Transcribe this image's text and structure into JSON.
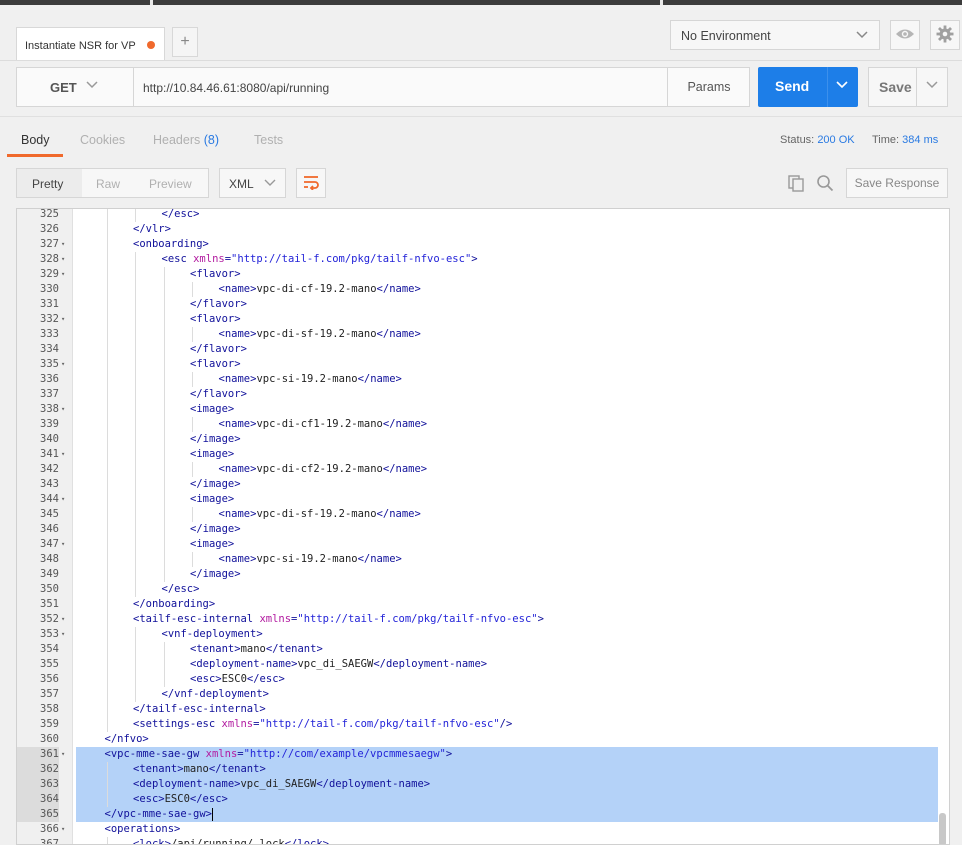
{
  "tabs": {
    "active_tab_label": "Instantiate NSR for VP",
    "add_tab_symbol": "+"
  },
  "environment": {
    "selected": "No Environment"
  },
  "request": {
    "method": "GET",
    "url": "http://10.84.46.61:8080/api/running",
    "params_label": "Params",
    "send_label": "Send",
    "save_label": "Save"
  },
  "response_tabs": {
    "body": "Body",
    "cookies": "Cookies",
    "headers": "Headers",
    "headers_count": "(8)",
    "tests": "Tests"
  },
  "response_status": {
    "status_label": "Status:",
    "status_value": "200 OK",
    "time_label": "Time:",
    "time_value": "384 ms"
  },
  "view_modes": {
    "pretty": "Pretty",
    "raw": "Raw",
    "preview": "Preview",
    "format": "XML",
    "save_response": "Save Response"
  },
  "colors": {
    "send_blue": "#1d7ee8",
    "accent_orange": "#f0692c",
    "selection": "#b4d2f8",
    "xml_tag": "#10109a",
    "xml_attr": "#b21ba0",
    "xml_string": "#2323d8"
  },
  "code_lines": [
    {
      "n": "325",
      "fold": false,
      "indent": 3,
      "parts": [
        [
          "t",
          "</esc>"
        ]
      ]
    },
    {
      "n": "326",
      "fold": false,
      "indent": 2,
      "parts": [
        [
          "t",
          "</vlr>"
        ]
      ]
    },
    {
      "n": "327",
      "fold": true,
      "indent": 2,
      "parts": [
        [
          "t",
          "<onboarding>"
        ]
      ]
    },
    {
      "n": "328",
      "fold": true,
      "indent": 3,
      "parts": [
        [
          "t",
          "<esc "
        ],
        [
          "a",
          "xmlns"
        ],
        [
          "t",
          "="
        ],
        [
          "s",
          "\"http://tail-f.com/pkg/tailf-nfvo-esc\""
        ],
        [
          "t",
          ">"
        ]
      ]
    },
    {
      "n": "329",
      "fold": true,
      "indent": 4,
      "parts": [
        [
          "t",
          "<flavor>"
        ]
      ]
    },
    {
      "n": "330",
      "fold": false,
      "indent": 5,
      "parts": [
        [
          "t",
          "<name>"
        ],
        [
          "x",
          "vpc-di-cf-19.2-mano"
        ],
        [
          "t",
          "</name>"
        ]
      ]
    },
    {
      "n": "331",
      "fold": false,
      "indent": 4,
      "parts": [
        [
          "t",
          "</flavor>"
        ]
      ]
    },
    {
      "n": "332",
      "fold": true,
      "indent": 4,
      "parts": [
        [
          "t",
          "<flavor>"
        ]
      ]
    },
    {
      "n": "333",
      "fold": false,
      "indent": 5,
      "parts": [
        [
          "t",
          "<name>"
        ],
        [
          "x",
          "vpc-di-sf-19.2-mano"
        ],
        [
          "t",
          "</name>"
        ]
      ]
    },
    {
      "n": "334",
      "fold": false,
      "indent": 4,
      "parts": [
        [
          "t",
          "</flavor>"
        ]
      ]
    },
    {
      "n": "335",
      "fold": true,
      "indent": 4,
      "parts": [
        [
          "t",
          "<flavor>"
        ]
      ]
    },
    {
      "n": "336",
      "fold": false,
      "indent": 5,
      "parts": [
        [
          "t",
          "<name>"
        ],
        [
          "x",
          "vpc-si-19.2-mano"
        ],
        [
          "t",
          "</name>"
        ]
      ]
    },
    {
      "n": "337",
      "fold": false,
      "indent": 4,
      "parts": [
        [
          "t",
          "</flavor>"
        ]
      ]
    },
    {
      "n": "338",
      "fold": true,
      "indent": 4,
      "parts": [
        [
          "t",
          "<image>"
        ]
      ]
    },
    {
      "n": "339",
      "fold": false,
      "indent": 5,
      "parts": [
        [
          "t",
          "<name>"
        ],
        [
          "x",
          "vpc-di-cf1-19.2-mano"
        ],
        [
          "t",
          "</name>"
        ]
      ]
    },
    {
      "n": "340",
      "fold": false,
      "indent": 4,
      "parts": [
        [
          "t",
          "</image>"
        ]
      ]
    },
    {
      "n": "341",
      "fold": true,
      "indent": 4,
      "parts": [
        [
          "t",
          "<image>"
        ]
      ]
    },
    {
      "n": "342",
      "fold": false,
      "indent": 5,
      "parts": [
        [
          "t",
          "<name>"
        ],
        [
          "x",
          "vpc-di-cf2-19.2-mano"
        ],
        [
          "t",
          "</name>"
        ]
      ]
    },
    {
      "n": "343",
      "fold": false,
      "indent": 4,
      "parts": [
        [
          "t",
          "</image>"
        ]
      ]
    },
    {
      "n": "344",
      "fold": true,
      "indent": 4,
      "parts": [
        [
          "t",
          "<image>"
        ]
      ]
    },
    {
      "n": "345",
      "fold": false,
      "indent": 5,
      "parts": [
        [
          "t",
          "<name>"
        ],
        [
          "x",
          "vpc-di-sf-19.2-mano"
        ],
        [
          "t",
          "</name>"
        ]
      ]
    },
    {
      "n": "346",
      "fold": false,
      "indent": 4,
      "parts": [
        [
          "t",
          "</image>"
        ]
      ]
    },
    {
      "n": "347",
      "fold": true,
      "indent": 4,
      "parts": [
        [
          "t",
          "<image>"
        ]
      ]
    },
    {
      "n": "348",
      "fold": false,
      "indent": 5,
      "parts": [
        [
          "t",
          "<name>"
        ],
        [
          "x",
          "vpc-si-19.2-mano"
        ],
        [
          "t",
          "</name>"
        ]
      ]
    },
    {
      "n": "349",
      "fold": false,
      "indent": 4,
      "parts": [
        [
          "t",
          "</image>"
        ]
      ]
    },
    {
      "n": "350",
      "fold": false,
      "indent": 3,
      "parts": [
        [
          "t",
          "</esc>"
        ]
      ]
    },
    {
      "n": "351",
      "fold": false,
      "indent": 2,
      "parts": [
        [
          "t",
          "</onboarding>"
        ]
      ]
    },
    {
      "n": "352",
      "fold": true,
      "indent": 2,
      "parts": [
        [
          "t",
          "<tailf-esc-internal "
        ],
        [
          "a",
          "xmlns"
        ],
        [
          "t",
          "="
        ],
        [
          "s",
          "\"http://tail-f.com/pkg/tailf-nfvo-esc\""
        ],
        [
          "t",
          ">"
        ]
      ]
    },
    {
      "n": "353",
      "fold": true,
      "indent": 3,
      "parts": [
        [
          "t",
          "<vnf-deployment>"
        ]
      ]
    },
    {
      "n": "354",
      "fold": false,
      "indent": 4,
      "parts": [
        [
          "t",
          "<tenant>"
        ],
        [
          "x",
          "mano"
        ],
        [
          "t",
          "</tenant>"
        ]
      ]
    },
    {
      "n": "355",
      "fold": false,
      "indent": 4,
      "parts": [
        [
          "t",
          "<deployment-name>"
        ],
        [
          "x",
          "vpc_di_SAEGW"
        ],
        [
          "t",
          "</deployment-name>"
        ]
      ]
    },
    {
      "n": "356",
      "fold": false,
      "indent": 4,
      "parts": [
        [
          "t",
          "<esc>"
        ],
        [
          "x",
          "ESC0"
        ],
        [
          "t",
          "</esc>"
        ]
      ]
    },
    {
      "n": "357",
      "fold": false,
      "indent": 3,
      "parts": [
        [
          "t",
          "</vnf-deployment>"
        ]
      ]
    },
    {
      "n": "358",
      "fold": false,
      "indent": 2,
      "parts": [
        [
          "t",
          "</tailf-esc-internal>"
        ]
      ]
    },
    {
      "n": "359",
      "fold": false,
      "indent": 2,
      "parts": [
        [
          "t",
          "<settings-esc "
        ],
        [
          "a",
          "xmlns"
        ],
        [
          "t",
          "="
        ],
        [
          "s",
          "\"http://tail-f.com/pkg/tailf-nfvo-esc\""
        ],
        [
          "t",
          "/>"
        ]
      ]
    },
    {
      "n": "360",
      "fold": false,
      "indent": 1,
      "parts": [
        [
          "t",
          "</nfvo>"
        ]
      ]
    },
    {
      "n": "361",
      "fold": true,
      "indent": 1,
      "sel": true,
      "parts": [
        [
          "t",
          "<vpc-mme-sae-gw "
        ],
        [
          "a",
          "xmlns"
        ],
        [
          "t",
          "="
        ],
        [
          "s",
          "\"http://com/example/vpcmmesaegw\""
        ],
        [
          "t",
          ">"
        ]
      ]
    },
    {
      "n": "362",
      "fold": false,
      "indent": 2,
      "sel": true,
      "parts": [
        [
          "t",
          "<tenant>"
        ],
        [
          "x",
          "mano"
        ],
        [
          "t",
          "</tenant>"
        ]
      ]
    },
    {
      "n": "363",
      "fold": false,
      "indent": 2,
      "sel": true,
      "parts": [
        [
          "t",
          "<deployment-name>"
        ],
        [
          "x",
          "vpc_di_SAEGW"
        ],
        [
          "t",
          "</deployment-name>"
        ]
      ]
    },
    {
      "n": "364",
      "fold": false,
      "indent": 2,
      "sel": true,
      "parts": [
        [
          "t",
          "<esc>"
        ],
        [
          "x",
          "ESC0"
        ],
        [
          "t",
          "</esc>"
        ]
      ]
    },
    {
      "n": "365",
      "fold": false,
      "indent": 1,
      "sel": true,
      "cursor": true,
      "parts": [
        [
          "t",
          "</vpc-mme-sae-gw>"
        ]
      ]
    },
    {
      "n": "366",
      "fold": true,
      "indent": 1,
      "parts": [
        [
          "t",
          "<operations>"
        ]
      ]
    },
    {
      "n": "367",
      "fold": false,
      "indent": 2,
      "parts": [
        [
          "t",
          "<lock>"
        ],
        [
          "x",
          "/api/running/_lock"
        ],
        [
          "t",
          "</lock>"
        ]
      ]
    }
  ]
}
